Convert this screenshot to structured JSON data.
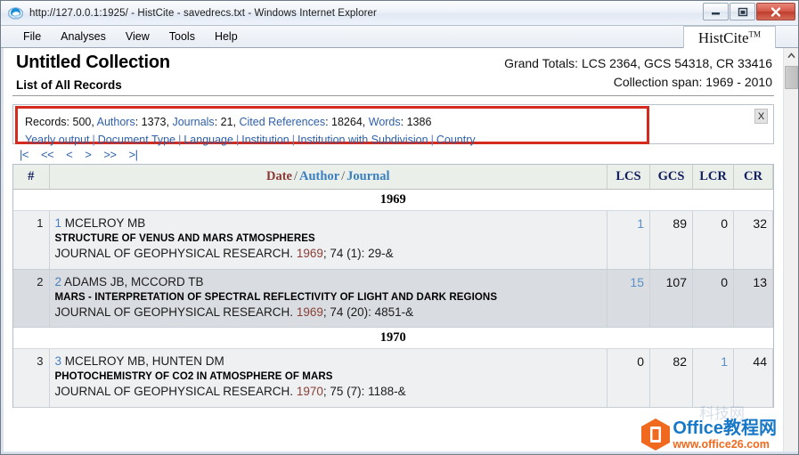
{
  "window": {
    "title": "http://127.0.0.1:1925/ - HistCite - savedrecs.txt - Windows Internet Explorer",
    "icon": "internet-explorer-icon",
    "minimize_label": "—",
    "restore_label": "❐",
    "close_label": "✕"
  },
  "menubar": {
    "items": [
      {
        "label": "File"
      },
      {
        "label": "Analyses"
      },
      {
        "label": "View"
      },
      {
        "label": "Tools"
      },
      {
        "label": "Help"
      }
    ],
    "brand": "HistCite",
    "brand_tm": "TM"
  },
  "collection": {
    "title": "Untitled Collection",
    "subtitle": "List of All Records",
    "grand_totals": "Grand Totals: LCS 2364, GCS 54318, CR 33416",
    "span": "Collection span: 1969 - 2010"
  },
  "info_box": {
    "close_label": "X",
    "stats": [
      {
        "label": "Records:",
        "value": "500",
        "is_link": false
      },
      {
        "label": "Authors:",
        "value": "1373",
        "is_link": true
      },
      {
        "label": "Journals:",
        "value": "21",
        "is_link": true
      },
      {
        "label": "Cited References:",
        "value": "18264",
        "is_link": true
      },
      {
        "label": "Words:",
        "value": "1386",
        "is_link": false
      }
    ],
    "stats_text_records": "Records: 500,",
    "stats_authors_label": "Authors",
    "stats_authors_value": ": 1373,",
    "stats_journals_label": "Journals",
    "stats_journals_value": ": 21,",
    "stats_cited_label": "Cited References",
    "stats_cited_value": ": 18264,",
    "stats_words_label": "Words",
    "stats_words_value": ": 1386",
    "links": [
      "Yearly output",
      "Document Type",
      "Language",
      "Institution",
      "Institution with Subdivision",
      "Country"
    ],
    "separator": "|",
    "border_color": "#d52b1e"
  },
  "pager": {
    "buttons": [
      "|<",
      "<<",
      "<",
      ">",
      ">>",
      ">|"
    ]
  },
  "table": {
    "headers": {
      "num": "#",
      "date": "Date",
      "slash": "/",
      "author": "Author",
      "journal": "Journal",
      "lcs": "LCS",
      "gcs": "GCS",
      "lcr": "LCR",
      "cr": "CR"
    },
    "groups": [
      {
        "year": "1969",
        "rows": [
          {
            "num": "1",
            "recid": "1",
            "authors": "MCELROY MB",
            "title": "STRUCTURE OF VENUS AND MARS ATMOSPHERES",
            "journal": "JOURNAL OF GEOPHYSICAL RESEARCH.",
            "year": "1969",
            "citation": "; 74 (1): 29-&",
            "lcs": "1",
            "lcs_link": true,
            "gcs": "89",
            "gcs_link": false,
            "lcr": "0",
            "lcr_link": false,
            "cr": "32",
            "cr_link": false,
            "shade": "plain"
          },
          {
            "num": "2",
            "recid": "2",
            "authors": "ADAMS JB, MCCORD TB",
            "title": "MARS - INTERPRETATION OF SPECTRAL REFLECTIVITY OF LIGHT AND DARK REGIONS",
            "journal": "JOURNAL OF GEOPHYSICAL RESEARCH.",
            "year": "1969",
            "citation": "; 74 (20): 4851-&",
            "lcs": "15",
            "lcs_link": true,
            "gcs": "107",
            "gcs_link": false,
            "lcr": "0",
            "lcr_link": false,
            "cr": "13",
            "cr_link": false,
            "shade": "alt"
          }
        ]
      },
      {
        "year": "1970",
        "rows": [
          {
            "num": "3",
            "recid": "3",
            "authors": "MCELROY MB, HUNTEN DM",
            "title": "PHOTOCHEMISTRY OF CO2 IN ATMOSPHERE OF MARS",
            "journal": "JOURNAL OF GEOPHYSICAL RESEARCH.",
            "year": "1970",
            "citation": "; 75 (7): 1188-&",
            "lcs": "0",
            "lcs_link": false,
            "gcs": "82",
            "gcs_link": false,
            "lcr": "1",
            "lcr_link": true,
            "cr": "44",
            "cr_link": false,
            "shade": "plain"
          }
        ]
      }
    ]
  },
  "watermark": {
    "brand_en": "Office",
    "brand_cn": "教程网",
    "url": "www.office26.com",
    "ghost": "科技网",
    "hex_color": "#ef6a1e",
    "text_color": "#1878c8"
  }
}
